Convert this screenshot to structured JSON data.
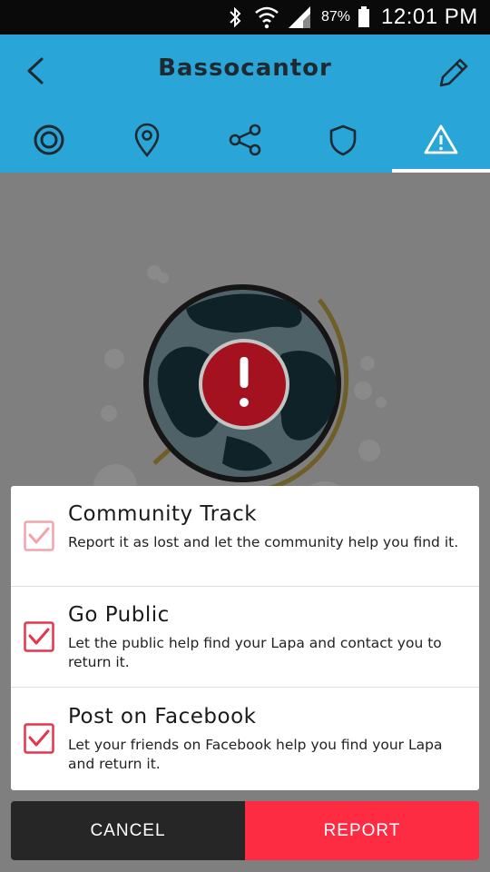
{
  "status_bar": {
    "battery_percent": "87%",
    "time": "12:01 PM",
    "icons": [
      "bluetooth-icon",
      "wifi-icon",
      "signal-icon",
      "battery-icon"
    ]
  },
  "header": {
    "title": "Bassocantor",
    "back_icon": "back-arrow-icon",
    "edit_icon": "pencil-icon"
  },
  "tabs": [
    {
      "icon": "target-icon",
      "active": false
    },
    {
      "icon": "location-pin-icon",
      "active": false
    },
    {
      "icon": "share-icon",
      "active": false
    },
    {
      "icon": "shield-icon",
      "active": false
    },
    {
      "icon": "warning-icon",
      "active": true
    }
  ],
  "illustration": {
    "icon": "globe-alert-icon"
  },
  "options": [
    {
      "title": "Community Track",
      "description": "Report it as lost and let the community help you find it.",
      "checked": true,
      "disabled": true
    },
    {
      "title": "Go Public",
      "description": "Let the public help find your Lapa and contact you to return it.",
      "checked": true,
      "disabled": false
    },
    {
      "title": "Post on Facebook",
      "description": "Let your friends on Facebook help you find your Lapa and return it.",
      "checked": true,
      "disabled": false
    }
  ],
  "actions": {
    "cancel_label": "CANCEL",
    "report_label": "REPORT"
  },
  "colors": {
    "app_bar": "#2aa5d8",
    "report": "#fe2c43",
    "cancel": "#262626",
    "check": "#e8334a"
  }
}
